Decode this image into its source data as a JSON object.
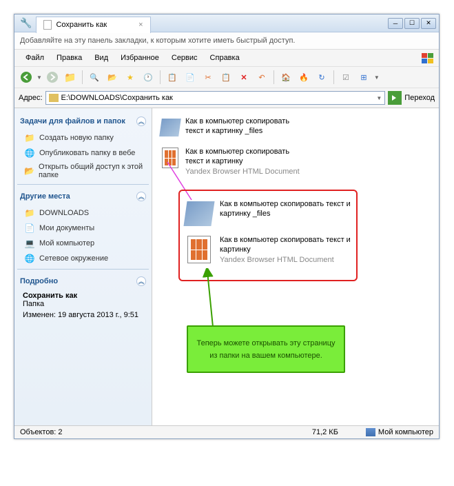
{
  "titlebar": {
    "tab_title": "Сохранить как"
  },
  "bookmark_hint": "Добавляйте на эту панель закладки, к которым хотите иметь быстрый доступ.",
  "menu": {
    "file": "Файл",
    "edit": "Правка",
    "view": "Вид",
    "favorites": "Избранное",
    "tools": "Сервис",
    "help": "Справка"
  },
  "address": {
    "label": "Адрес:",
    "path": "E:\\DOWNLOADS\\Сохранить как",
    "go": "Переход"
  },
  "sidebar": {
    "tasks_title": "Задачи для файлов и папок",
    "tasks": [
      "Создать новую папку",
      "Опубликовать папку в вебе",
      "Открыть общий доступ к этой папке"
    ],
    "places_title": "Другие места",
    "places": [
      "DOWNLOADS",
      "Мои документы",
      "Мой компьютер",
      "Сетевое окружение"
    ],
    "details_title": "Подробно",
    "details": {
      "name": "Сохранить как",
      "type": "Папка",
      "modified": "Изменен: 19 августа 2013 г., 9:51"
    }
  },
  "files": {
    "folder_name": "Как в компьютер скопировать текст и картинку _files",
    "html_name": "Как в компьютер скопировать текст и картинку",
    "html_type": "Yandex Browser HTML Document"
  },
  "callout_text": "Теперь можете открывать эту страницу из папки на вашем компьютере.",
  "statusbar": {
    "objects": "Объектов: 2",
    "size": "71,2 КБ",
    "location": "Мой компьютер"
  }
}
